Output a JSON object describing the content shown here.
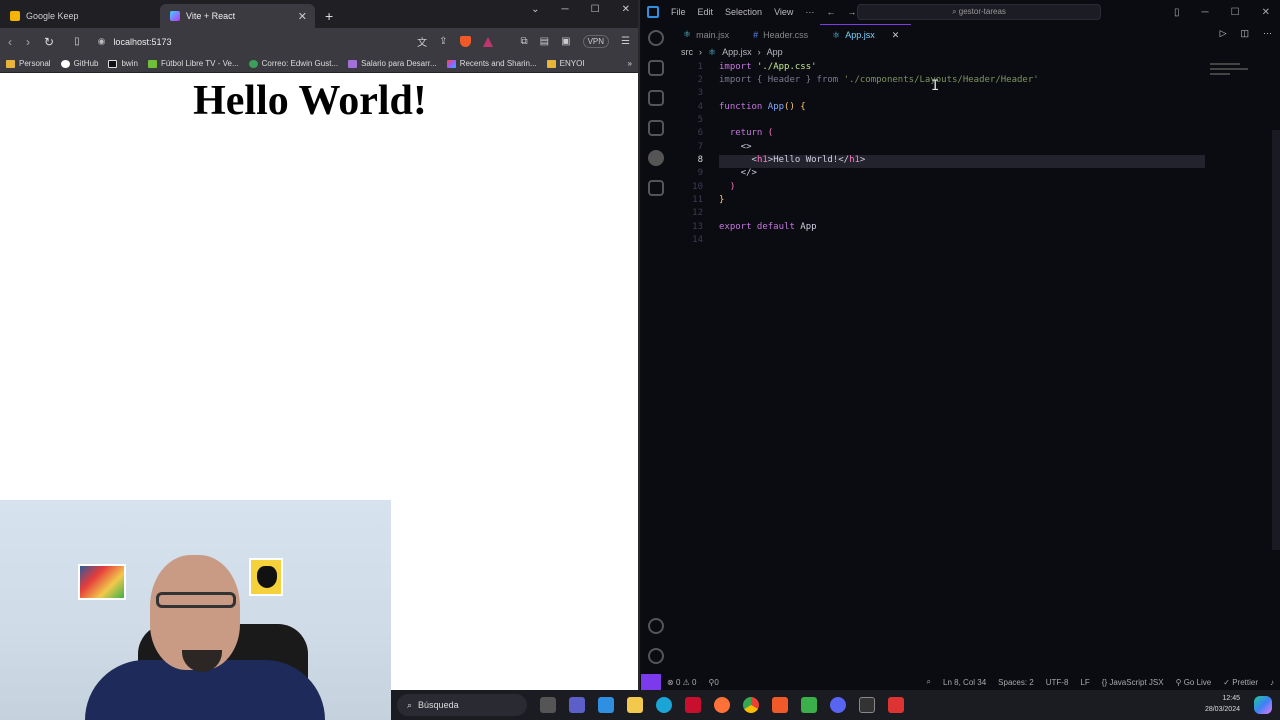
{
  "browser": {
    "tabs": [
      {
        "title": "Google Keep",
        "active": false,
        "icon": "google-keep-icon"
      },
      {
        "title": "Vite + React",
        "active": true,
        "icon": "vite-icon"
      }
    ],
    "url": "localhost:5173",
    "vpn_label": "VPN",
    "bookmarks": [
      "Personal",
      "GitHub",
      "bwin",
      "Fútbol Libre TV - Ve...",
      "Correo: Edwin Gust...",
      "Salario para Desarr...",
      "Recents and Sharin...",
      "ENYOI"
    ],
    "page_heading": "Hello World!"
  },
  "vscode": {
    "menu": [
      "File",
      "Edit",
      "Selection",
      "View",
      "···"
    ],
    "search_placeholder": "gestor-tareas",
    "tabs": [
      {
        "name": "main.jsx",
        "active": false
      },
      {
        "name": "Header.css",
        "active": false
      },
      {
        "name": "App.jsx",
        "active": true
      }
    ],
    "breadcrumb": [
      "src",
      "App.jsx",
      "App"
    ],
    "current_line": 8,
    "status": {
      "errors": "0",
      "warnings": "0",
      "ports": "0",
      "position": "Ln 8, Col 34",
      "spaces": "Spaces: 2",
      "encoding": "UTF-8",
      "eol": "LF",
      "language": "JavaScript JSX",
      "golive": "Go Live",
      "prettier": "Prettier"
    }
  },
  "taskbar": {
    "search_label": "Búsqueda",
    "time": "12:45",
    "date": "28/03/2024"
  },
  "colors": {
    "accent": "#7c3aed",
    "brave": "#f05a28"
  }
}
